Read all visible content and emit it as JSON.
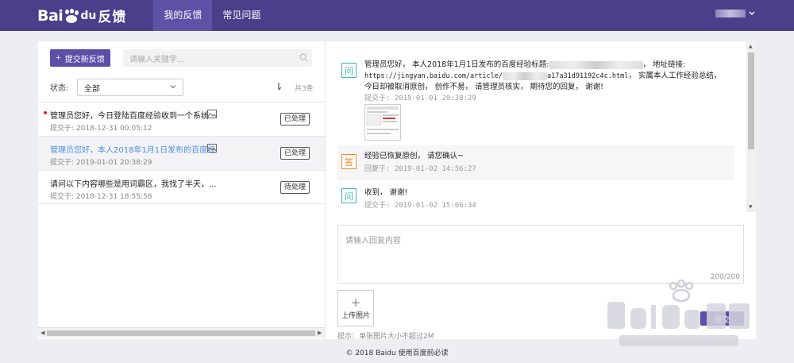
{
  "header": {
    "logo_text_bai": "Bai",
    "logo_text_du": "du",
    "logo_text_app": "反馈",
    "tabs": [
      {
        "label": "我的反馈",
        "active": true
      },
      {
        "label": "常见问题",
        "active": false
      }
    ],
    "accent_color": "#4b3f8c"
  },
  "sidebar": {
    "submit_label": "提交新反馈",
    "search_placeholder": "请输入关键字...",
    "status_label": "状态:",
    "status_value": "全部",
    "count_text": "共3条",
    "items": [
      {
        "title": "管理员您好，今日登陆百度经验收到一个系统 ...",
        "time": "提交于: 2018-12-31 00:05:12",
        "status": "已处理",
        "unread": true
      },
      {
        "title": "管理员您好，本人2018年1月1日发布的百度经...",
        "time": "提交于: 2019-01-01 20:38:29",
        "status": "已处理",
        "selected": true
      },
      {
        "title": "请问以下内容哪些是用词霸区，我找了半天，...",
        "time": "提交于: 2018-12-31 18:55:58",
        "status": "待处理"
      }
    ]
  },
  "conversation": {
    "messages": [
      {
        "badge": "问",
        "text_a": "管理员您好， 本人2018年1月1日发布的百度经验标题:",
        "text_b": "，  地址链接:",
        "url_a": "https://jingyan.baidu.com/article/",
        "url_b": "a17a31d91192c4c.html",
        "text_c": "， 实属本人工作经验总结， 今日却被取消原创， 创作不易， 请管理员核实， 期待您的回复， 谢谢!",
        "time": "提交于:  2019-01-01 20:38:29"
      },
      {
        "badge": "答",
        "text": "经验已恢复原创， 请您确认~",
        "time": "回复于:  2019-01-02 14:56:27"
      },
      {
        "badge": "问",
        "text": "收到， 谢谢!",
        "time": "提交于:  2019-01-02 15:06:34"
      }
    ]
  },
  "reply": {
    "placeholder": "请输入回复内容",
    "counter": "200/200",
    "upload_label": "上传图片",
    "tip": "提示：单张图片大小不超过2M",
    "submit_label": "提交"
  },
  "footer": {
    "text": "© 2018 Baidu 使用百度前必读"
  }
}
